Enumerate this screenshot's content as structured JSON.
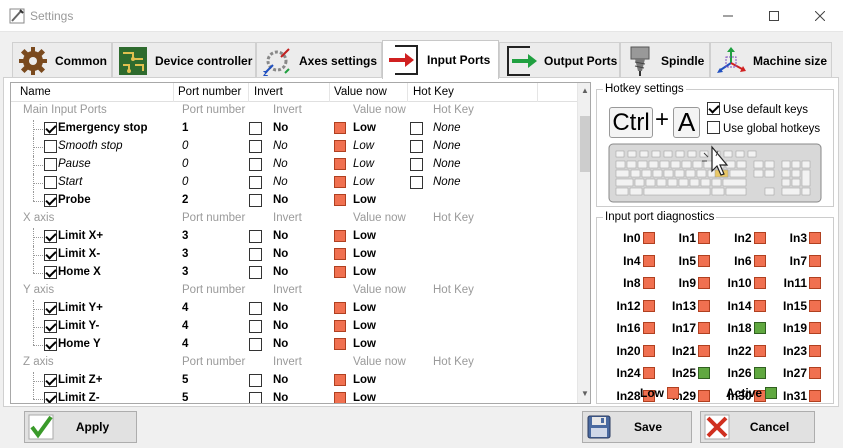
{
  "window": {
    "title": "Settings"
  },
  "tabs": [
    {
      "label": "Common",
      "icon": "gear-icon"
    },
    {
      "label": "Device controller",
      "icon": "circuit-board-icon"
    },
    {
      "label": "Axes settings",
      "icon": "axes-icon"
    },
    {
      "label": "Input Ports",
      "icon": "input-arrow-icon",
      "active": true
    },
    {
      "label": "Output Ports",
      "icon": "output-arrow-icon"
    },
    {
      "label": "Spindle",
      "icon": "spindle-icon"
    },
    {
      "label": "Machine size",
      "icon": "machine-size-icon"
    }
  ],
  "grid": {
    "columns": [
      "Name",
      "Port number",
      "Invert",
      "Value now",
      "Hot Key"
    ],
    "sections": [
      {
        "name": "Main Input Ports",
        "sub": [
          "Port number",
          "Invert",
          "Value now",
          "Hot Key"
        ],
        "rows": [
          {
            "name": "Emergency stop",
            "enabled": true,
            "port": "1",
            "invert": false,
            "invert_text": "No",
            "value": "Low",
            "hotkey": "None",
            "has_hotkey": true
          },
          {
            "name": "Smooth stop",
            "enabled": false,
            "port": "0",
            "invert": false,
            "invert_text": "No",
            "value": "Low",
            "hotkey": "None",
            "has_hotkey": true
          },
          {
            "name": "Pause",
            "enabled": false,
            "port": "0",
            "invert": false,
            "invert_text": "No",
            "value": "Low",
            "hotkey": "None",
            "has_hotkey": true
          },
          {
            "name": "Start",
            "enabled": false,
            "port": "0",
            "invert": false,
            "invert_text": "No",
            "value": "Low",
            "hotkey": "None",
            "has_hotkey": true
          },
          {
            "name": "Probe",
            "enabled": true,
            "port": "2",
            "invert": false,
            "invert_text": "No",
            "value": "Low",
            "hotkey": "",
            "has_hotkey": false
          }
        ]
      },
      {
        "name": "X axis",
        "sub": [
          "Port number",
          "Invert",
          "Value now",
          "Hot Key"
        ],
        "rows": [
          {
            "name": "Limit X+",
            "enabled": true,
            "port": "3",
            "invert": false,
            "invert_text": "No",
            "value": "Low"
          },
          {
            "name": "Limit X-",
            "enabled": true,
            "port": "3",
            "invert": false,
            "invert_text": "No",
            "value": "Low"
          },
          {
            "name": "Home X",
            "enabled": true,
            "port": "3",
            "invert": false,
            "invert_text": "No",
            "value": "Low"
          }
        ]
      },
      {
        "name": "Y axis",
        "sub": [
          "Port number",
          "Invert",
          "Value now",
          "Hot Key"
        ],
        "rows": [
          {
            "name": "Limit Y+",
            "enabled": true,
            "port": "4",
            "invert": false,
            "invert_text": "No",
            "value": "Low"
          },
          {
            "name": "Limit Y-",
            "enabled": true,
            "port": "4",
            "invert": false,
            "invert_text": "No",
            "value": "Low"
          },
          {
            "name": "Home Y",
            "enabled": true,
            "port": "4",
            "invert": false,
            "invert_text": "No",
            "value": "Low"
          }
        ]
      },
      {
        "name": "Z axis",
        "sub": [
          "Port number",
          "Invert",
          "Value now",
          "Hot Key"
        ],
        "rows": [
          {
            "name": "Limit Z+",
            "enabled": true,
            "port": "5",
            "invert": false,
            "invert_text": "No",
            "value": "Low"
          },
          {
            "name": "Limit Z-",
            "enabled": true,
            "port": "5",
            "invert": false,
            "invert_text": "No",
            "value": "Low"
          }
        ]
      }
    ]
  },
  "hotkeys": {
    "title": "Hotkey settings",
    "key1": "Ctrl",
    "plus": "+",
    "key2": "A",
    "use_default_label": "Use default keys",
    "use_default": true,
    "use_global_label": "Use global hotkeys",
    "use_global": false
  },
  "diagnostics": {
    "title": "Input port diagnostics",
    "ports": [
      {
        "label": "In0",
        "state": "low"
      },
      {
        "label": "In1",
        "state": "low"
      },
      {
        "label": "In2",
        "state": "low"
      },
      {
        "label": "In3",
        "state": "low"
      },
      {
        "label": "In4",
        "state": "low"
      },
      {
        "label": "In5",
        "state": "low"
      },
      {
        "label": "In6",
        "state": "low"
      },
      {
        "label": "In7",
        "state": "low"
      },
      {
        "label": "In8",
        "state": "low"
      },
      {
        "label": "In9",
        "state": "low"
      },
      {
        "label": "In10",
        "state": "low"
      },
      {
        "label": "In11",
        "state": "low"
      },
      {
        "label": "In12",
        "state": "low"
      },
      {
        "label": "In13",
        "state": "low"
      },
      {
        "label": "In14",
        "state": "low"
      },
      {
        "label": "In15",
        "state": "low"
      },
      {
        "label": "In16",
        "state": "low"
      },
      {
        "label": "In17",
        "state": "low"
      },
      {
        "label": "In18",
        "state": "active"
      },
      {
        "label": "In19",
        "state": "low"
      },
      {
        "label": "In20",
        "state": "low"
      },
      {
        "label": "In21",
        "state": "low"
      },
      {
        "label": "In22",
        "state": "low"
      },
      {
        "label": "In23",
        "state": "low"
      },
      {
        "label": "In24",
        "state": "low"
      },
      {
        "label": "In25",
        "state": "active"
      },
      {
        "label": "In26",
        "state": "active"
      },
      {
        "label": "In27",
        "state": "low"
      },
      {
        "label": "In28",
        "state": "low"
      },
      {
        "label": "In29",
        "state": "low"
      },
      {
        "label": "In30",
        "state": "low"
      },
      {
        "label": "In31",
        "state": "low"
      }
    ],
    "legend_low": "Low",
    "legend_active": "Active"
  },
  "buttons": {
    "apply": "Apply",
    "save": "Save",
    "cancel": "Cancel"
  },
  "colors": {
    "low": "#f07050",
    "active": "#60a840"
  }
}
